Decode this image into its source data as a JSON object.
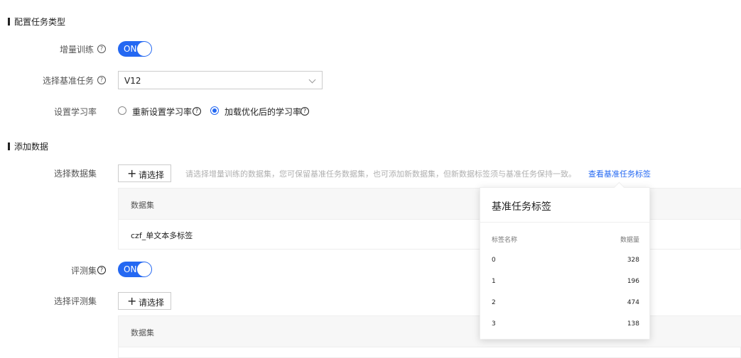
{
  "sections": {
    "task_type": {
      "title": "配置任务类型"
    },
    "data": {
      "title": "添加数据"
    }
  },
  "incremental": {
    "label": "增量训练",
    "state": "ON"
  },
  "base_task": {
    "label": "选择基准任务",
    "value": "V12"
  },
  "learning_rate": {
    "label": "设置学习率",
    "options": [
      {
        "label": "重新设置学习率",
        "checked": false
      },
      {
        "label": "加载优化后的学习率",
        "checked": true
      }
    ]
  },
  "dataset": {
    "label": "选择数据集",
    "button": "请选择",
    "hint": "请选择增量训练的数据集，您可保留基准任务数据集，也可添加新数据集，但新数据标签须与基准任务保持一致。",
    "link": "查看基准任务标签",
    "table_header": "数据集",
    "rows": [
      "czf_单文本多标签"
    ]
  },
  "eval": {
    "label": "评测集",
    "state": "ON"
  },
  "eval_select": {
    "label": "选择评测集",
    "button": "请选择",
    "table_header": "数据集"
  },
  "popover": {
    "title": "基准任务标签",
    "col_name": "标签名称",
    "col_count": "数据量",
    "rows": [
      {
        "name": "0",
        "count": "328"
      },
      {
        "name": "1",
        "count": "196"
      },
      {
        "name": "2",
        "count": "474"
      },
      {
        "name": "3",
        "count": "138"
      }
    ]
  },
  "colors": {
    "accent": "#2468f2",
    "hint": "#b0b0b0"
  }
}
